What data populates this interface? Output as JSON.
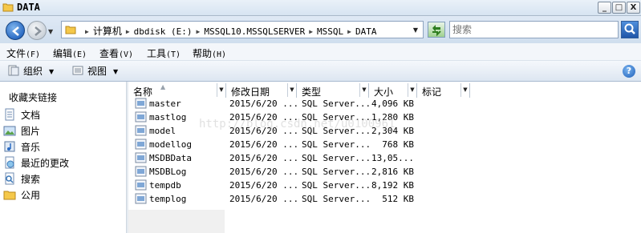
{
  "window": {
    "title": "DATA",
    "btn_min": "_",
    "btn_max": "□",
    "btn_close": "X"
  },
  "address": {
    "crumbs": [
      "计算机",
      "dbdisk (E:)",
      "MSSQL10.MSSQLSERVER",
      "MSSQL",
      "DATA"
    ],
    "search_placeholder": "搜索"
  },
  "menu": {
    "file": {
      "label": "文件",
      "acc": "(F)"
    },
    "edit": {
      "label": "编辑",
      "acc": "(E)"
    },
    "view": {
      "label": "查看",
      "acc": "(V)"
    },
    "tools": {
      "label": "工具",
      "acc": "(T)"
    },
    "help": {
      "label": "帮助",
      "acc": "(H)"
    }
  },
  "toolbar": {
    "organize": "组织",
    "views": "视图",
    "help_glyph": "?"
  },
  "nav": {
    "favorites_header": "收藏夹链接",
    "items": [
      {
        "label": "文档",
        "icon": "documents-icon"
      },
      {
        "label": "图片",
        "icon": "pictures-icon"
      },
      {
        "label": "音乐",
        "icon": "music-icon"
      },
      {
        "label": "最近的更改",
        "icon": "recent-changes-icon"
      },
      {
        "label": "搜索",
        "icon": "search-icon"
      },
      {
        "label": "公用",
        "icon": "public-folder-icon"
      }
    ]
  },
  "columns": {
    "name": "名称",
    "date": "修改日期",
    "type": "类型",
    "size": "大小",
    "tags": "标记"
  },
  "files": [
    {
      "name": "master",
      "date": "2015/6/20 ...",
      "type": "SQL Server...",
      "size": "4,096 KB"
    },
    {
      "name": "mastlog",
      "date": "2015/6/20 ...",
      "type": "SQL Server...",
      "size": "1,280 KB"
    },
    {
      "name": "model",
      "date": "2015/6/20 ...",
      "type": "SQL Server...",
      "size": "2,304 KB"
    },
    {
      "name": "modellog",
      "date": "2015/6/20 ...",
      "type": "SQL Server...",
      "size": "768 KB"
    },
    {
      "name": "MSDBData",
      "date": "2015/6/20 ...",
      "type": "SQL Server...",
      "size": "13,05..."
    },
    {
      "name": "MSDBLog",
      "date": "2015/6/20 ...",
      "type": "SQL Server...",
      "size": "2,816 KB"
    },
    {
      "name": "tempdb",
      "date": "2015/6/20 ...",
      "type": "SQL Server...",
      "size": "8,192 KB"
    },
    {
      "name": "templog",
      "date": "2015/6/20 ...",
      "type": "SQL Server...",
      "size": "512 KB"
    }
  ],
  "watermark": "http://blog.csdn.net/u0100961",
  "colors": {
    "accent": "#2c6cc4",
    "folder": "#f5c84a"
  }
}
